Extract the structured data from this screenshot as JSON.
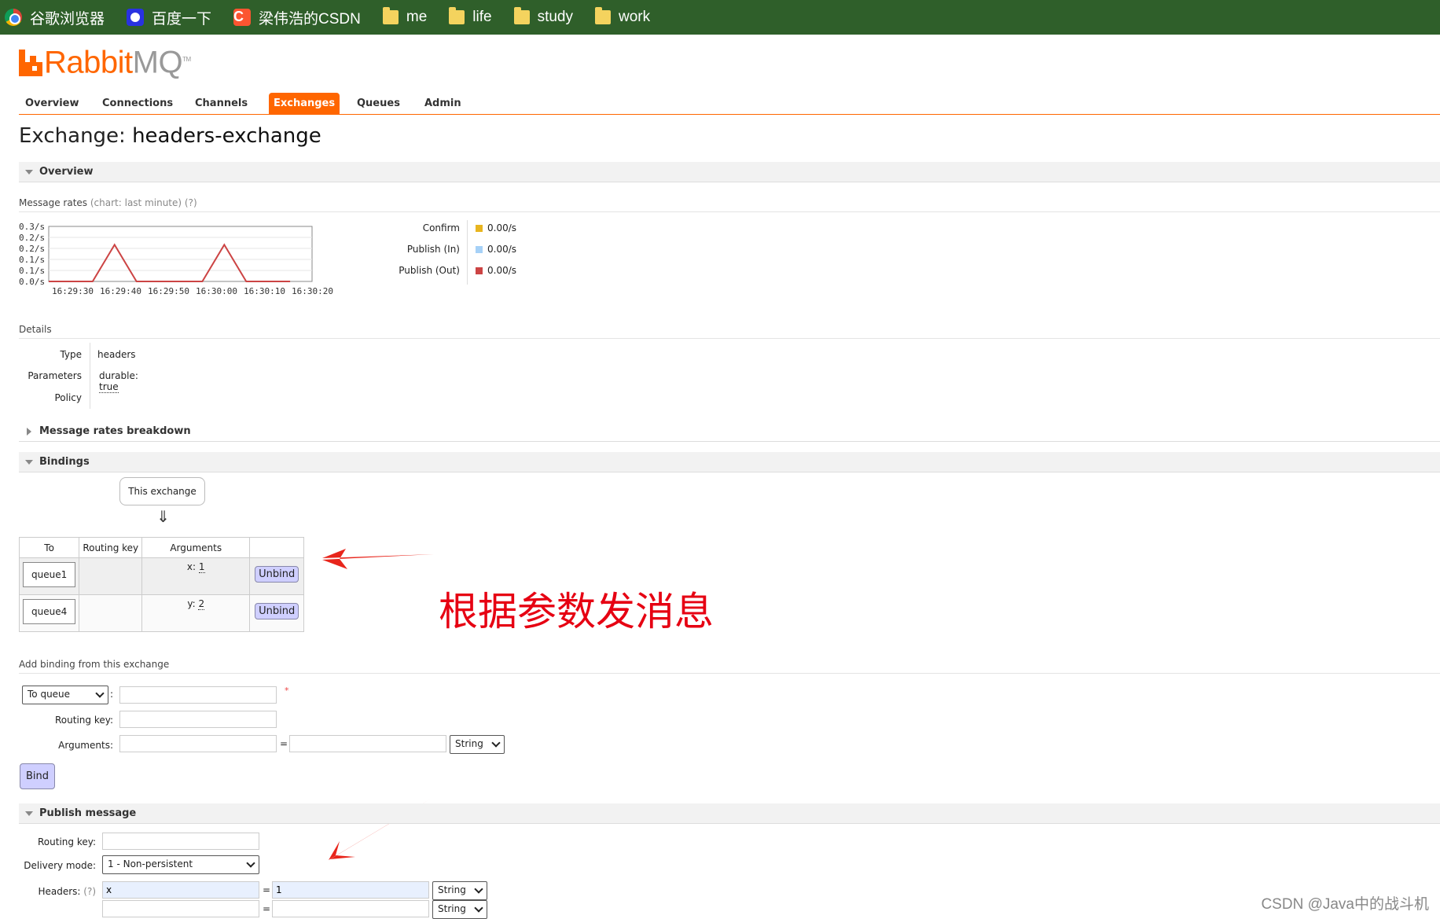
{
  "bookmarks": [
    {
      "label": "谷歌浏览器",
      "icon": "chrome-icon"
    },
    {
      "label": "百度一下",
      "icon": "baidu-icon"
    },
    {
      "label": "梁伟浩的CSDN",
      "icon": "csdn-icon"
    },
    {
      "label": "me",
      "icon": "folder-icon"
    },
    {
      "label": "life",
      "icon": "folder-icon"
    },
    {
      "label": "study",
      "icon": "folder-icon"
    },
    {
      "label": "work",
      "icon": "folder-icon"
    }
  ],
  "logo": {
    "rabbit": "Rabbit",
    "mq": "MQ",
    "tm": "TM"
  },
  "nav": {
    "tabs": [
      "Overview",
      "Connections",
      "Channels",
      "Exchanges",
      "Queues",
      "Admin"
    ],
    "active": "Exchanges"
  },
  "page": {
    "title_prefix": "Exchange:",
    "exchange_name": "headers-exchange"
  },
  "overview": {
    "section_title": "Overview",
    "rates_title": "Message rates",
    "rates_note": "(chart: last minute) (?)"
  },
  "chart_data": {
    "type": "line",
    "x": [
      "16:29:30",
      "16:29:40",
      "16:29:50",
      "16:30:00",
      "16:30:10",
      "16:30:20"
    ],
    "y_tick_labels": [
      "0.3/s",
      "0.2/s",
      "0.2/s",
      "0.1/s",
      "0.1/s",
      "0.0/s"
    ],
    "ylim": [
      0,
      0.3
    ],
    "series": [
      {
        "name": "Publish (Out)",
        "color": "#c44",
        "points": [
          [
            0,
            0
          ],
          [
            10,
            0
          ],
          [
            15,
            0.2
          ],
          [
            20,
            0
          ],
          [
            35,
            0
          ],
          [
            40,
            0.2
          ],
          [
            45,
            0
          ],
          [
            55,
            0
          ]
        ]
      }
    ],
    "grid": true
  },
  "legend": [
    {
      "label": "Confirm",
      "value": "0.00/s",
      "color": "#e8b520"
    },
    {
      "label": "Publish (In)",
      "value": "0.00/s",
      "color": "#a6d1f7"
    },
    {
      "label": "Publish (Out)",
      "value": "0.00/s",
      "color": "#c44"
    }
  ],
  "details": {
    "title": "Details",
    "type_label": "Type",
    "type_value": "headers",
    "params_label": "Parameters",
    "params_key": "durable:",
    "params_value": "true",
    "policy_label": "Policy"
  },
  "breakdown": {
    "title": "Message rates breakdown"
  },
  "bindings": {
    "section_title": "Bindings",
    "this_exchange": "This exchange",
    "down_arrow": "⇓",
    "headers": [
      "To",
      "Routing key",
      "Arguments",
      ""
    ],
    "rows": [
      {
        "queue": "queue1",
        "routing_key": "",
        "arg_key": "x:",
        "arg_value": "1",
        "action": "Unbind"
      },
      {
        "queue": "queue4",
        "routing_key": "",
        "arg_key": "y:",
        "arg_value": "2",
        "action": "Unbind"
      }
    ]
  },
  "annotation": "根据参数发消息",
  "add_binding": {
    "title": "Add binding from this exchange",
    "destination_type": "To queue",
    "colon": ":",
    "required_mark": "*",
    "routing_key_label": "Routing key:",
    "arguments_label": "Arguments:",
    "equals": "=",
    "arg_type": "String",
    "bind_button": "Bind"
  },
  "publish": {
    "section_title": "Publish message",
    "routing_key_label": "Routing key:",
    "delivery_mode_label": "Delivery mode:",
    "delivery_mode_value": "1 - Non-persistent",
    "headers_label": "Headers:",
    "headers_help": "(?)",
    "header_rows": [
      {
        "key": "x",
        "value": "1",
        "type": "String"
      },
      {
        "key": "",
        "value": "",
        "type": "String"
      }
    ],
    "equals": "="
  },
  "watermark": "CSDN @Java中的战斗机"
}
